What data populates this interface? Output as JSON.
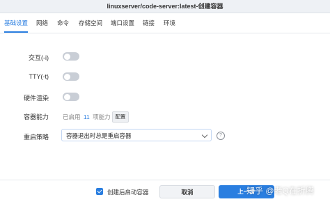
{
  "window": {
    "title": "linuxserver/code-server:latest-创建容器"
  },
  "tabs": [
    {
      "label": "基础设置",
      "active": true
    },
    {
      "label": "网络"
    },
    {
      "label": "命令"
    },
    {
      "label": "存储空间"
    },
    {
      "label": "端口设置"
    },
    {
      "label": "链接"
    },
    {
      "label": "环境"
    }
  ],
  "form": {
    "interactive_label": "交互(-i)",
    "interactive_on": false,
    "tty_label": "TTY(-t)",
    "tty_on": false,
    "gpu_label": "硬件渲染",
    "gpu_on": false,
    "capability_label": "容器能力",
    "capability_prefix": "已启用",
    "capability_count": "11",
    "capability_suffix": "项能力",
    "configure_label": "配置",
    "restart_label": "重启策略",
    "restart_value": "容器退出时总是重启容器"
  },
  "footer": {
    "start_after_create_label": "创建后启动容器",
    "start_after_create_checked": true,
    "cancel_label": "取消",
    "next_label": "上一步"
  },
  "watermark": "知乎 @老Q在折腾",
  "colors": {
    "accent": "#2a7ee0",
    "toggle_off": "#c9ced6"
  }
}
